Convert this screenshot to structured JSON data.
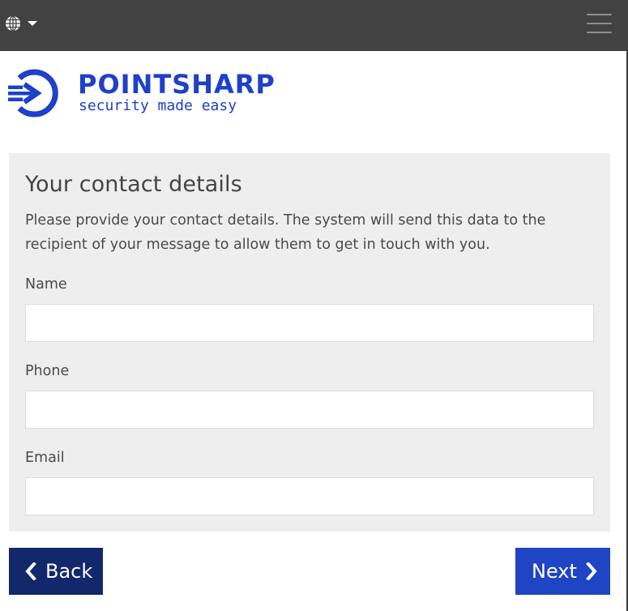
{
  "header": {
    "language_icon": "globe-icon",
    "dropdown_icon": "caret-down-icon",
    "menu_icon": "hamburger-menu-icon"
  },
  "logo": {
    "name": "POINTSHARP",
    "tagline": "security made easy",
    "brand_color": "#1f40c8"
  },
  "form": {
    "title": "Your contact details",
    "description": "Please provide your contact details. The system will send this data to the recipient of your message to allow them to get in touch with you.",
    "fields": {
      "name": {
        "label": "Name",
        "value": ""
      },
      "phone": {
        "label": "Phone",
        "value": ""
      },
      "email": {
        "label": "Email",
        "value": ""
      }
    }
  },
  "actions": {
    "back_label": "Back",
    "back_icon": "chevron-left-icon",
    "back_color": "#12286b",
    "next_label": "Next",
    "next_icon": "chevron-right-icon",
    "next_color": "#1f45c4"
  }
}
